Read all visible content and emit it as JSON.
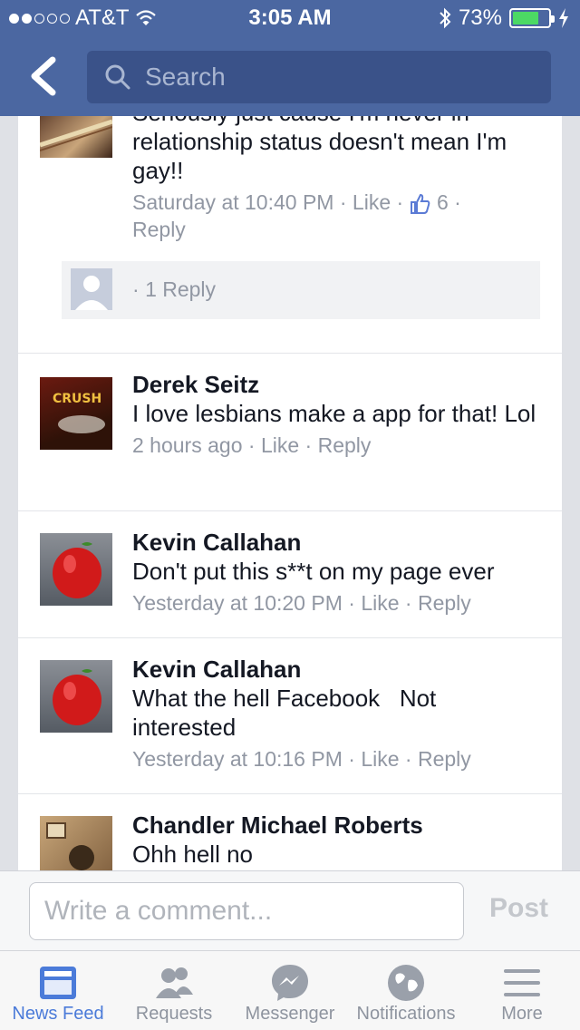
{
  "status_bar": {
    "carrier": "AT&T",
    "time": "3:05 AM",
    "battery": "73%",
    "battery_level": 0.73,
    "signal_bars": 2
  },
  "nav": {
    "search_placeholder": "Search"
  },
  "comments": [
    {
      "name": "",
      "body": "Seriously just cause I'm never in relationship status doesn't mean I'm gay!!",
      "time": "Saturday at 10:40 PM",
      "like": "Like",
      "likes_count": "6",
      "reply": "Reply",
      "replies_link": "1 Reply"
    },
    {
      "name": "Derek Seitz",
      "body": "I love lesbians make a app for that! Lol",
      "time": "2 hours ago",
      "like": "Like",
      "reply": "Reply",
      "avatar_text": "CRUSH"
    },
    {
      "name": "Kevin Callahan",
      "body": "Don't put this s**t on my page ever",
      "time": "Yesterday at 10:20 PM",
      "like": "Like",
      "reply": "Reply"
    },
    {
      "name": "Kevin Callahan",
      "body": "What the hell Facebook   Not interested",
      "time": "Yesterday at 10:16 PM",
      "like": "Like",
      "reply": "Reply"
    },
    {
      "name": "Chandler Michael Roberts",
      "body": "Ohh hell no"
    }
  ],
  "composer": {
    "placeholder": "Write a comment...",
    "post_label": "Post"
  },
  "tabs": [
    {
      "label": "News Feed",
      "icon": "news-feed-icon",
      "active": true
    },
    {
      "label": "Requests",
      "icon": "requests-icon",
      "active": false
    },
    {
      "label": "Messenger",
      "icon": "messenger-icon",
      "active": false
    },
    {
      "label": "Notifications",
      "icon": "notifications-icon",
      "active": false
    },
    {
      "label": "More",
      "icon": "more-icon",
      "active": false
    }
  ],
  "colors": {
    "brand": "#4b67a1",
    "active_tab": "#4b7bd9",
    "meta_text": "#9197a3",
    "battery_fill": "#4cd964"
  }
}
